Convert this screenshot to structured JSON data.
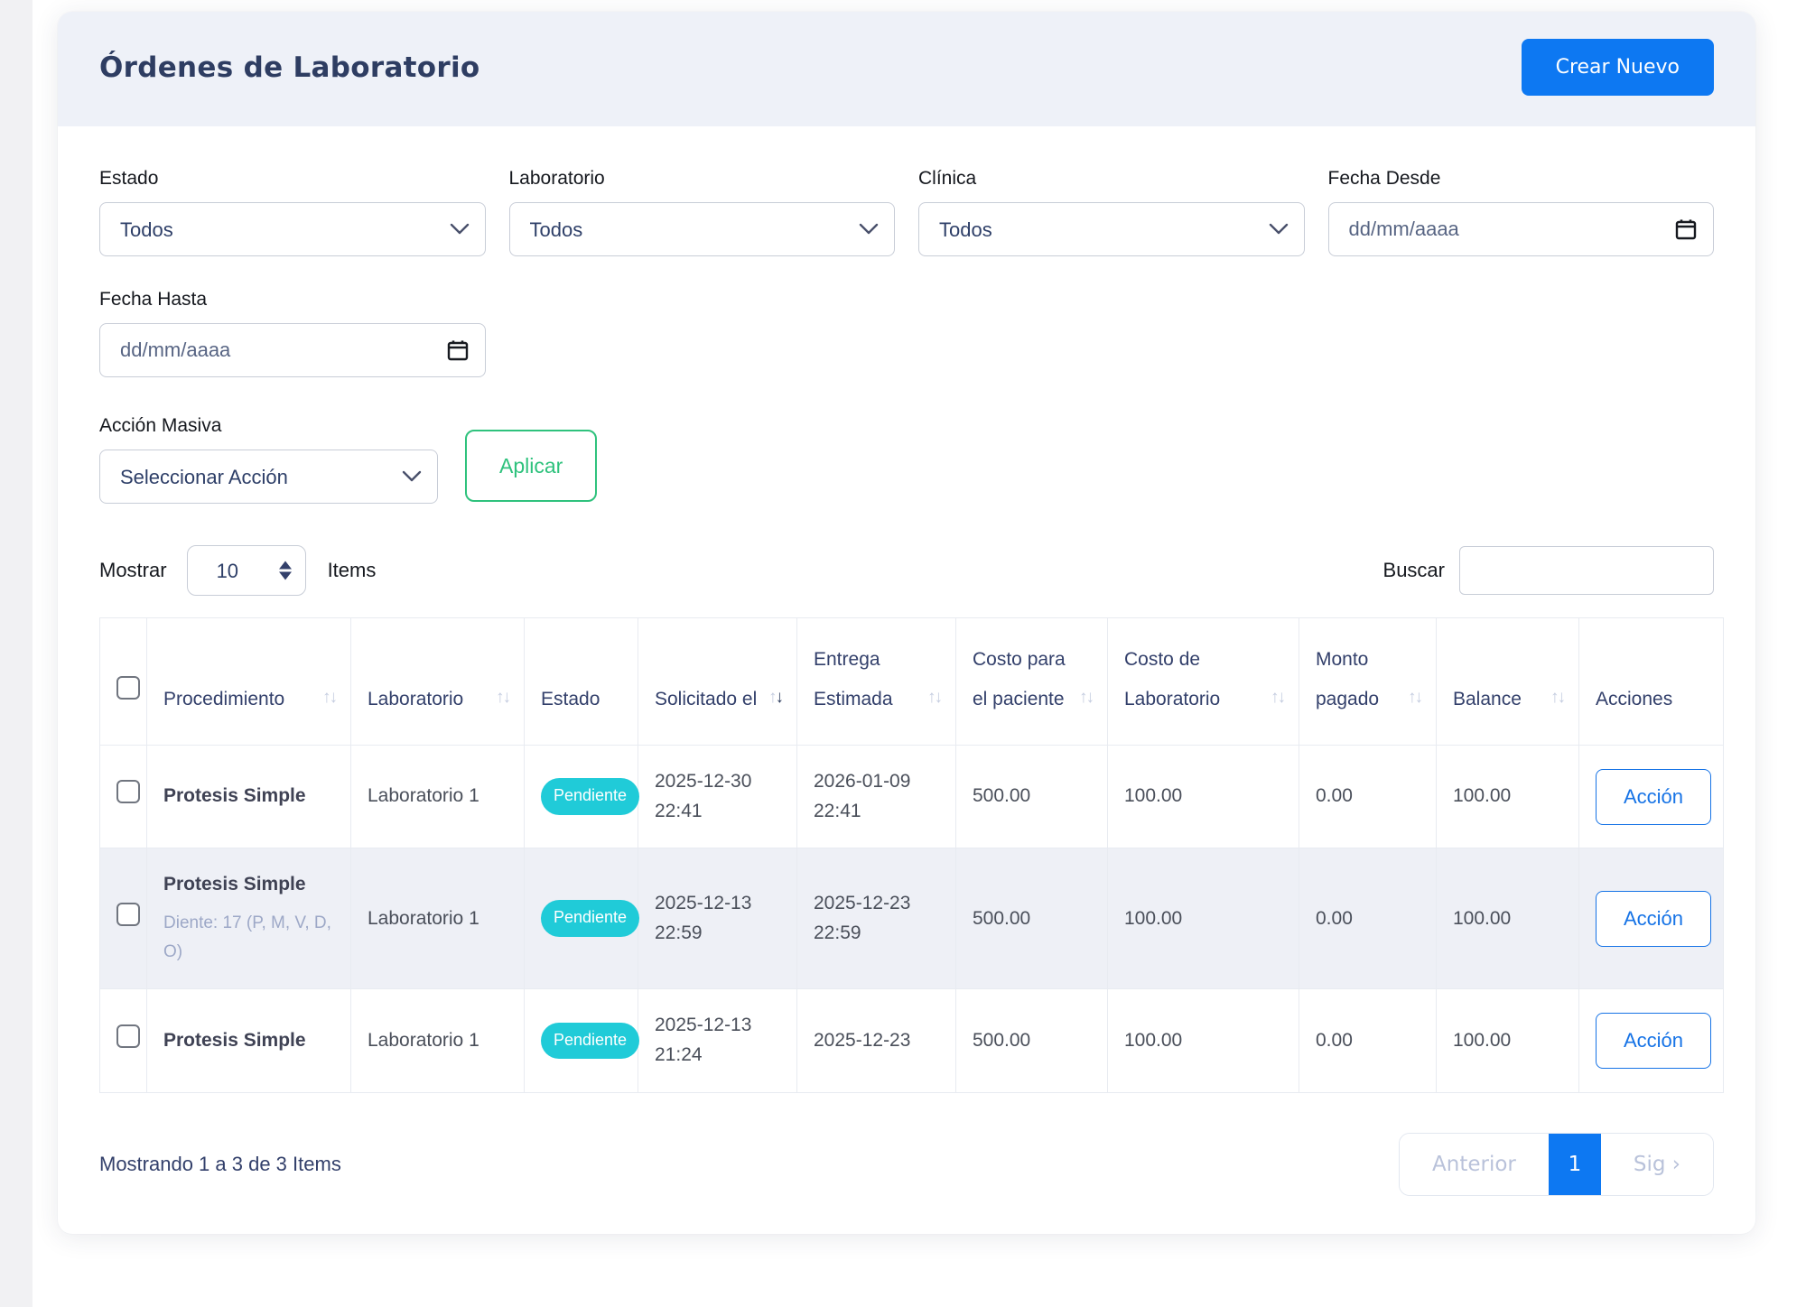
{
  "page": {
    "title": "Órdenes de Laboratorio",
    "create_button_label": "Crear Nuevo"
  },
  "filters": {
    "estado": {
      "label": "Estado",
      "value": "Todos"
    },
    "laboratorio": {
      "label": "Laboratorio",
      "value": "Todos"
    },
    "clinica": {
      "label": "Clínica",
      "value": "Todos"
    },
    "fecha_desde": {
      "label": "Fecha Desde",
      "placeholder": "dd/mm/aaaa",
      "value": ""
    },
    "fecha_hasta": {
      "label": "Fecha Hasta",
      "placeholder": "dd/mm/aaaa",
      "value": ""
    }
  },
  "bulk_action": {
    "label": "Acción Masiva",
    "select_value": "Seleccionar Acción",
    "apply_button_label": "Aplicar"
  },
  "list_controls": {
    "show_label": "Mostrar",
    "page_size": "10",
    "items_label": "Items",
    "search_label": "Buscar",
    "search_value": ""
  },
  "table": {
    "headers": [
      {
        "label": "Procedimiento",
        "sortable": true,
        "sort": null
      },
      {
        "label": "Laboratorio",
        "sortable": true,
        "sort": null
      },
      {
        "label": "Estado",
        "sortable": false,
        "sort": null
      },
      {
        "label": "Solicitado el",
        "sortable": true,
        "sort": "desc"
      },
      {
        "label": "Entrega Estimada",
        "sortable": true,
        "sort": null
      },
      {
        "label": "Costo para el paciente",
        "sortable": true,
        "sort": null
      },
      {
        "label": "Costo de Laboratorio",
        "sortable": true,
        "sort": null
      },
      {
        "label": "Monto pagado",
        "sortable": true,
        "sort": null
      },
      {
        "label": "Balance",
        "sortable": true,
        "sort": null
      },
      {
        "label": "Acciones",
        "sortable": false,
        "sort": null
      }
    ],
    "rows": [
      {
        "procedimiento": "Protesis Simple",
        "detalle": "",
        "laboratorio": "Laboratorio 1",
        "estado": "Pendiente",
        "solicitado": "2025-12-30 22:41",
        "entrega": "2026-01-09 22:41",
        "costo_paciente": "500.00",
        "costo_laboratorio": "100.00",
        "monto_pagado": "0.00",
        "balance": "100.00",
        "accion_label": "Acción"
      },
      {
        "procedimiento": "Protesis Simple",
        "detalle": "Diente: 17 (P, M, V, D, O)",
        "laboratorio": "Laboratorio 1",
        "estado": "Pendiente",
        "solicitado": "2025-12-13 22:59",
        "entrega": "2025-12-23 22:59",
        "costo_paciente": "500.00",
        "costo_laboratorio": "100.00",
        "monto_pagado": "0.00",
        "balance": "100.00",
        "accion_label": "Acción"
      },
      {
        "procedimiento": "Protesis Simple",
        "detalle": "",
        "laboratorio": "Laboratorio 1",
        "estado": "Pendiente",
        "solicitado": "2025-12-13 21:24",
        "entrega": "2025-12-23",
        "costo_paciente": "500.00",
        "costo_laboratorio": "100.00",
        "monto_pagado": "0.00",
        "balance": "100.00",
        "accion_label": "Acción"
      }
    ]
  },
  "footer": {
    "summary": "Mostrando 1 a 3 de 3 Items",
    "pagination": {
      "prev_label": "Anterior",
      "current_page": "1",
      "next_label": "Sig ›"
    }
  },
  "colors": {
    "primary_blue": "#0d78f2",
    "header_bg": "#eef1f8",
    "title_navy": "#2e3d62",
    "success_green": "#2fc27d",
    "status_pendiente_cyan": "#20cbd8",
    "stripe_row_bg": "#eef0f6",
    "action_button_blue": "#1673e6",
    "muted_pagination_text": "#b9c2da"
  }
}
